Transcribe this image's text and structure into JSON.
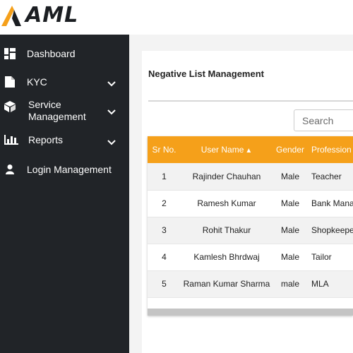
{
  "brand": {
    "name": "AML",
    "accent": "#f5a01a"
  },
  "sidebar": {
    "items": [
      {
        "label": "Dashboard",
        "icon": "dashboard-icon",
        "has_submenu": false
      },
      {
        "label": "KYC",
        "icon": "document-icon",
        "has_submenu": true
      },
      {
        "label": "Service\nManagement",
        "icon": "box-icon",
        "has_submenu": true
      },
      {
        "label": "Reports",
        "icon": "bar-chart-icon",
        "has_submenu": true
      },
      {
        "label": "Login Management",
        "icon": "user-icon",
        "has_submenu": false
      }
    ]
  },
  "page": {
    "title": "Negative List Management",
    "search_placeholder": "Search"
  },
  "table": {
    "columns": [
      "Sr No.",
      "User Name",
      "Gender",
      "Profession"
    ],
    "sort_icon": "sort-icon",
    "rows": [
      {
        "sr": "1",
        "name": "Rajinder Chauhan",
        "gender": "Male",
        "profession": "Teacher"
      },
      {
        "sr": "2",
        "name": "Ramesh Kumar",
        "gender": "Male",
        "profession": "Bank Manager"
      },
      {
        "sr": "3",
        "name": "Rohit Thakur",
        "gender": "Male",
        "profession": "Shopkeeper"
      },
      {
        "sr": "4",
        "name": "Kamlesh Bhrdwaj",
        "gender": "Male",
        "profession": "Tailor"
      },
      {
        "sr": "5",
        "name": "Raman Kumar Sharma",
        "gender": "male",
        "profession": "MLA"
      }
    ]
  }
}
